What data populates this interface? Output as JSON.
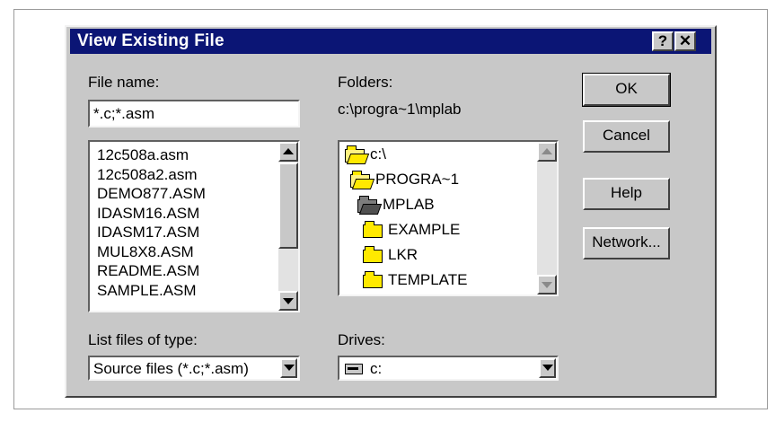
{
  "window": {
    "title": "View Existing File",
    "help_button": "?",
    "close_button": "✕"
  },
  "file_name": {
    "label": "File name:",
    "value": "*.c;*.asm",
    "files": [
      "12c508a.asm",
      "12c508a2.asm",
      "DEMO877.ASM",
      "IDASM16.ASM",
      "IDASM17.ASM",
      "MUL8X8.ASM",
      "README.ASM",
      "SAMPLE.ASM"
    ]
  },
  "folders": {
    "label": "Folders:",
    "path": "c:\\progra~1\\mplab",
    "tree": [
      {
        "label": "c:\\",
        "icon": "open-folder-icon"
      },
      {
        "label": "PROGRA~1",
        "icon": "open-folder-icon"
      },
      {
        "label": "MPLAB",
        "icon": "open-folder-icon"
      },
      {
        "label": "EXAMPLE",
        "icon": "folder-icon"
      },
      {
        "label": "LKR",
        "icon": "folder-icon"
      },
      {
        "label": "TEMPLATE",
        "icon": "folder-icon"
      }
    ]
  },
  "list_type": {
    "label": "List files of type:",
    "value": "Source files (*.c;*.asm)"
  },
  "drives": {
    "label": "Drives:",
    "value": "c:",
    "icon": "drive-icon"
  },
  "buttons": {
    "ok": "OK",
    "cancel": "Cancel",
    "help": "Help",
    "network": "Network..."
  },
  "colors": {
    "titlebar": "#0b1575",
    "dialog": "#c8c8c8",
    "folder": "#ffe900"
  }
}
